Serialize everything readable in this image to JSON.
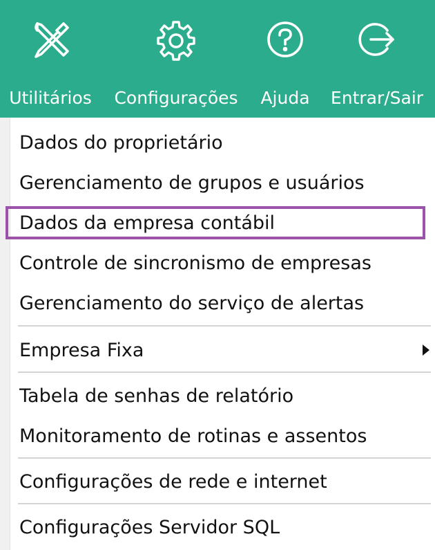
{
  "toolbar": {
    "background_color": "#2bac8c",
    "items": [
      {
        "label": "Utilitários",
        "icon": "tools-icon"
      },
      {
        "label": "Configurações",
        "icon": "gear-icon"
      },
      {
        "label": "Ajuda",
        "icon": "help-icon"
      },
      {
        "label": "Entrar/Sair",
        "icon": "logout-icon"
      }
    ]
  },
  "menu": {
    "items": [
      {
        "label": "Dados do proprietário"
      },
      {
        "label": "Gerenciamento de grupos e usuários"
      },
      {
        "label": "Dados da empresa contábil",
        "highlighted": true
      },
      {
        "label": "Controle de sincronismo de empresas"
      },
      {
        "label": "Gerenciamento do serviço de alertas"
      },
      {
        "label": "Empresa Fixa",
        "submenu": true
      },
      {
        "label": "Tabela de senhas de relatório"
      },
      {
        "label": "Monitoramento de rotinas e assentos"
      },
      {
        "label": "Configurações de rede e internet"
      },
      {
        "label": "Configurações Servidor SQL"
      }
    ],
    "highlight_color": "#9b52a8"
  }
}
